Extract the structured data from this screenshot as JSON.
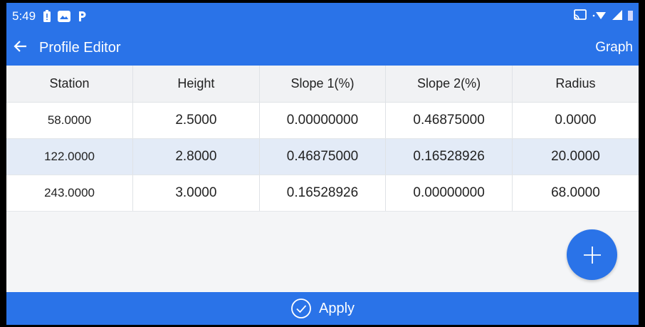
{
  "status_bar": {
    "time": "5:49",
    "left_icons": [
      "battery-alert-icon",
      "image-icon",
      "parking-icon"
    ],
    "right_icons": [
      "cast-icon",
      "wifi-icon",
      "signal-icon",
      "battery-icon"
    ]
  },
  "app_bar": {
    "back_icon": "arrow-left-icon",
    "title": "Profile Editor",
    "action_label": "Graph"
  },
  "table": {
    "columns": [
      "Station",
      "Height",
      "Slope 1(%)",
      "Slope 2(%)",
      "Radius"
    ],
    "rows": [
      [
        "58.0000",
        "2.5000",
        "0.00000000",
        "0.46875000",
        "0.0000"
      ],
      [
        "122.0000",
        "2.8000",
        "0.46875000",
        "0.16528926",
        "20.0000"
      ],
      [
        "243.0000",
        "3.0000",
        "0.16528926",
        "0.00000000",
        "68.0000"
      ]
    ],
    "selected_row": 1
  },
  "fab": {
    "icon": "plus-icon"
  },
  "footer": {
    "icon": "check-circle-icon",
    "label": "Apply"
  },
  "colors": {
    "primary": "#2a73e8",
    "selected_row": "#e3ebf7",
    "background": "#f4f5f7"
  }
}
